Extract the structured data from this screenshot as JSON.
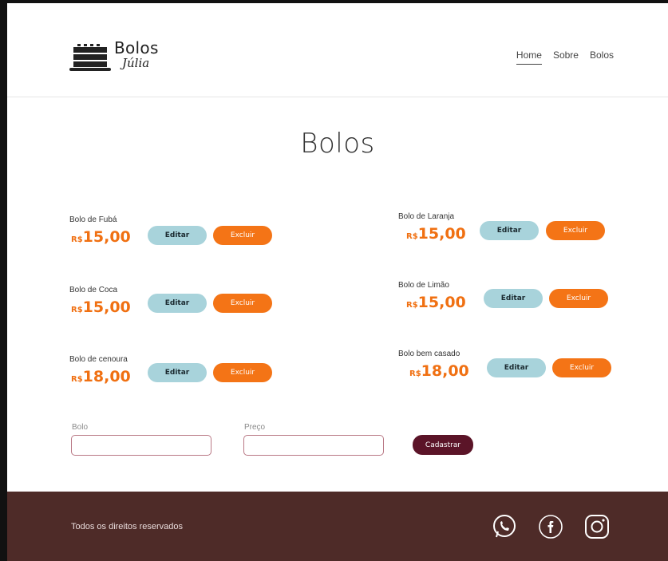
{
  "brand": {
    "name_line1": "Bolos",
    "name_line2": "Júlia",
    "icon": "cake-icon"
  },
  "nav": {
    "items": [
      {
        "label": "Home",
        "active": true
      },
      {
        "label": "Sobre",
        "active": false
      },
      {
        "label": "Bolos",
        "active": false
      }
    ]
  },
  "page_title": "Bolos",
  "currency": "R$",
  "cakes": [
    {
      "name": "Bolo de  Fubá",
      "price": "15,00",
      "edit_label": "Editar",
      "delete_label": "Excluir"
    },
    {
      "name": "Bolo de Laranja",
      "price": "15,00",
      "edit_label": "Editar",
      "delete_label": "Excluir"
    },
    {
      "name": "Bolo de Coca",
      "price": "15,00",
      "edit_label": "Editar",
      "delete_label": "Excluir"
    },
    {
      "name": "Bolo de Limão",
      "price": "15,00",
      "edit_label": "Editar",
      "delete_label": "Excluir"
    },
    {
      "name": "Bolo de cenoura",
      "price": "18,00",
      "edit_label": "Editar",
      "delete_label": "Excluir"
    },
    {
      "name": "Bolo bem casado",
      "price": "18,00",
      "edit_label": "Editar",
      "delete_label": "Excluir"
    }
  ],
  "form": {
    "cake_label": "Bolo",
    "cake_value": "",
    "price_label": "Preço",
    "price_value": "",
    "submit_label": "Cadastrar"
  },
  "footer": {
    "text": "Todos os direitos reservados",
    "social_icons": [
      "whatsapp-icon",
      "facebook-icon",
      "instagram-icon"
    ]
  },
  "colors": {
    "price": "#f07012",
    "edit_button": "#a8d3db",
    "delete_button": "#f47416",
    "submit_button": "#5b1428",
    "footer_bg": "#4e2b28"
  }
}
